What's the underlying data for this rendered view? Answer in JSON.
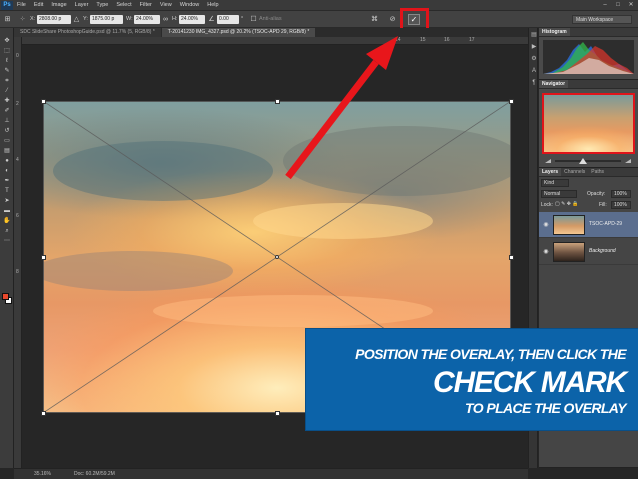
{
  "app": {
    "logo": "Ps",
    "menu": [
      "File",
      "Edit",
      "Image",
      "Layer",
      "Type",
      "Select",
      "Filter",
      "View",
      "Window",
      "Help"
    ],
    "window_controls": [
      "–",
      "□",
      "✕"
    ]
  },
  "options_bar": {
    "x_label": "X:",
    "x_value": "2808.00 p",
    "y_label": "Y:",
    "y_value": "1875.00 p",
    "w_label": "W:",
    "w_value": "24.00%",
    "h_label": "H:",
    "h_value": "24.00%",
    "angle_value": "0.00",
    "angle_unit": "°",
    "antialias_label": "Anti-alias",
    "workspace": "Main Workspace",
    "cancel_glyph": "⊘",
    "commit_glyph": "✓"
  },
  "tabs": [
    {
      "label": "SDC SlideShare PhotoshopGuide.psd @ 11.7% (5, RGB/8) *"
    },
    {
      "label": "T-20141230 IMG_4327.psd @ 20.2% (TSOC-APD 29, RGB/8) *"
    }
  ],
  "ruler": {
    "top_numbers": [
      "14",
      "15",
      "16",
      "17"
    ],
    "left_numbers": [
      "0",
      "2",
      "4",
      "6",
      "8"
    ]
  },
  "status_bar": {
    "zoom": "35.16%",
    "doc": "Doc: 60.2M/59.2M"
  },
  "panels": {
    "histogram_tab": "Histogram",
    "navigator_tab": "Navigator",
    "layer_tabs": [
      "Layers",
      "Channels",
      "Paths"
    ],
    "kind_label": "Kind",
    "blend_mode": "Normal",
    "opacity_label": "Opacity:",
    "opacity_value": "100%",
    "lock_label": "Lock:",
    "fill_label": "Fill:",
    "fill_value": "100%",
    "layers": [
      {
        "name": "TSOC-APD-29",
        "selected": true
      },
      {
        "name": "Background",
        "selected": false
      }
    ]
  },
  "banner": {
    "line1": "POSITION THE OVERLAY, THEN CLICK THE",
    "line2": "CHECK MARK",
    "line3": "TO PLACE THE OVERLAY"
  },
  "colors": {
    "highlight": "#e0141a",
    "banner": "#0c63a9",
    "selected_layer": "#5b6e8e"
  }
}
